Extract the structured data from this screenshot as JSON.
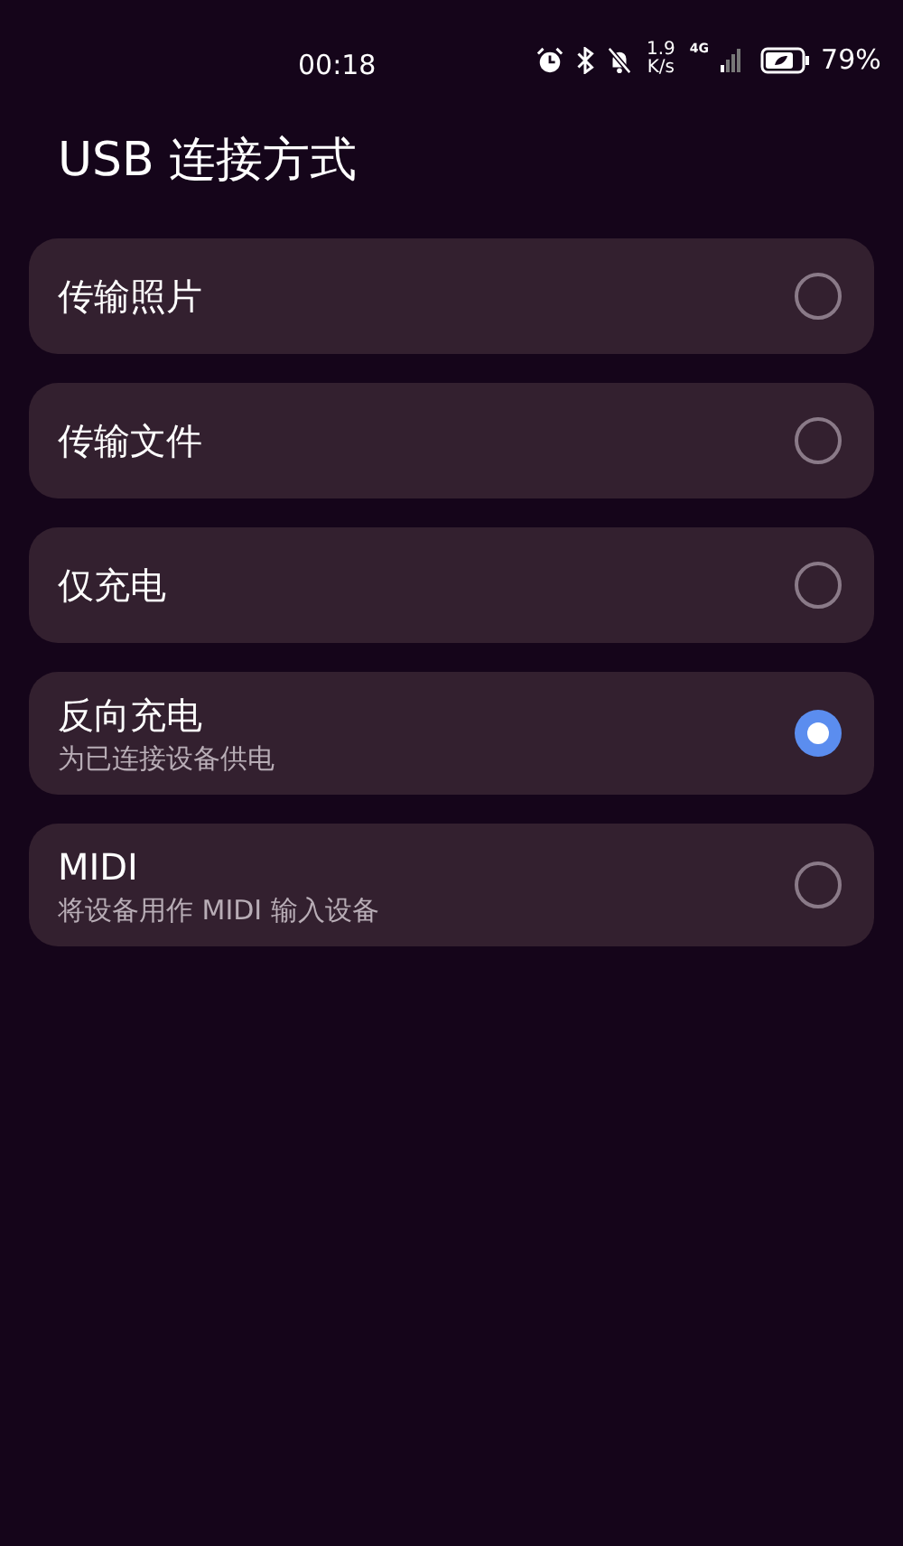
{
  "status_bar": {
    "time": "00:18",
    "speed_value": "1.9",
    "speed_unit": "K/s",
    "network": "4G",
    "battery": "79%"
  },
  "title": "USB 连接方式",
  "options": [
    {
      "label": "传输照片",
      "selected": false
    },
    {
      "label": "传输文件",
      "selected": false
    },
    {
      "label": "仅充电",
      "selected": false
    },
    {
      "label": "反向充电",
      "description": "为已连接设备供电",
      "selected": true
    },
    {
      "label": "MIDI",
      "description": "将设备用作 MIDI 输入设备",
      "selected": false
    }
  ]
}
